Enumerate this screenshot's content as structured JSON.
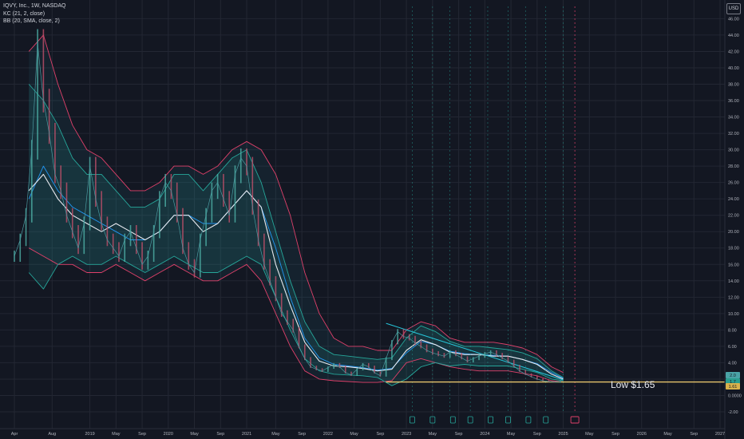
{
  "legend": {
    "line1": "IQVY, Inc., 1W, NASDAQ",
    "line2": "KC (21, 2, close)",
    "line3": "BB (20, SMA, close, 2)"
  },
  "currency": "USD",
  "annotation": {
    "text": "Low $1.65",
    "level": 1.65
  },
  "price_tags": [
    {
      "value": "2.0",
      "price": 2.0,
      "color": "#4aa3a6"
    },
    {
      "value": "1.7",
      "price": 1.7,
      "color": "#2a9d8f"
    },
    {
      "value": "1.61",
      "price": 1.61,
      "color": "#d9b24c"
    }
  ],
  "colors": {
    "background": "#131722",
    "grid": "#232733",
    "price": "#4a9aa0",
    "keltner": "#e0406a",
    "bollinger": "#26a69a",
    "basis": "#e8eaf0",
    "ema": "#2196f3",
    "support": "#e8c66d",
    "trendline": "#26c6da",
    "event_marker": "#26a69a",
    "session_line": "#26a69a",
    "cursor": "#e0406a"
  },
  "chart_data": {
    "type": "line",
    "x_axis": {
      "ticks": [
        "Apr",
        "Aug",
        "2019",
        "May",
        "Sep",
        "2020",
        "May",
        "Sep",
        "2021",
        "May",
        "Sep",
        "2022",
        "May",
        "Sep",
        "2023",
        "May",
        "Sep",
        "2024",
        "May",
        "Sep",
        "2025",
        "May",
        "Sep",
        "2026",
        "May",
        "Sep",
        "2027"
      ],
      "tick_index": [
        0,
        1.3,
        2.6,
        3.5,
        4.4,
        5.3,
        6.2,
        7.1,
        8.0,
        9.0,
        9.9,
        10.8,
        11.7,
        12.6,
        13.5,
        14.4,
        15.3,
        16.2,
        17.1,
        18.0,
        18.9,
        19.8,
        20.7,
        21.6,
        22.5,
        23.4,
        24.3
      ]
    },
    "y_axis": {
      "ylim": [
        -2.0,
        47.5
      ],
      "ticks": [
        "46.00",
        "44.00",
        "42.00",
        "40.00",
        "38.00",
        "36.00",
        "34.00",
        "32.00",
        "30.00",
        "28.00",
        "26.00",
        "24.00",
        "22.00",
        "20.00",
        "18.00",
        "16.00",
        "14.00",
        "12.00",
        "10.00",
        "8.00",
        "6.00",
        "4.00",
        "2.00",
        "0.0000",
        "-2.00"
      ],
      "tick_values": [
        46,
        44,
        42,
        40,
        38,
        36,
        34,
        32,
        30,
        28,
        26,
        24,
        22,
        20,
        18,
        16,
        14,
        12,
        10,
        8,
        6,
        4,
        2,
        0,
        -2
      ]
    },
    "grid": true,
    "series": [
      {
        "key": "close",
        "x": [
          0,
          0.2,
          0.4,
          0.6,
          0.8,
          1.0,
          1.2,
          1.4,
          1.6,
          1.8,
          2.0,
          2.2,
          2.4,
          2.6,
          2.8,
          3.0,
          3.2,
          3.4,
          3.6,
          3.8,
          4.0,
          4.2,
          4.4,
          4.6,
          4.8,
          5.0,
          5.2,
          5.4,
          5.6,
          5.8,
          6.0,
          6.2,
          6.4,
          6.6,
          6.8,
          7.0,
          7.2,
          7.4,
          7.6,
          7.8,
          8.0,
          8.2,
          8.4,
          8.6,
          8.8,
          9.0,
          9.2,
          9.4,
          9.6,
          9.8,
          10.0,
          10.2,
          10.4,
          10.6,
          10.8,
          11.0,
          11.2,
          11.4,
          11.6,
          11.8,
          12.0,
          12.2,
          12.4,
          12.6,
          12.8,
          13.0,
          13.2,
          13.4,
          13.6,
          13.8,
          14.0,
          14.2,
          14.4,
          14.6,
          14.8,
          15.0,
          15.2,
          15.4,
          15.6,
          15.8,
          16.0,
          16.2,
          16.4,
          16.6,
          16.8,
          17.0,
          17.2,
          17.4,
          17.6,
          17.8,
          18.0,
          18.2,
          18.4,
          18.6,
          18.8
        ],
        "values": [
          17,
          19,
          22,
          30,
          43,
          36,
          32,
          27,
          25,
          22,
          20,
          18,
          21,
          28,
          24,
          21,
          19,
          18,
          17,
          19,
          20,
          18,
          16,
          17,
          20,
          24,
          26,
          25,
          22,
          18,
          16,
          15,
          19,
          22,
          25,
          26,
          24,
          22,
          27,
          29,
          28,
          23,
          19,
          16,
          14,
          12,
          10,
          9,
          8,
          6,
          4.5,
          3.5,
          3.2,
          3.0,
          3.4,
          3.8,
          3.5,
          2.8,
          2.5,
          3.2,
          3.8,
          3.5,
          2.8,
          2.4,
          4.5,
          6.5,
          7.8,
          7.2,
          7.0,
          6.4,
          6.0,
          5.5,
          5.2,
          5.0,
          4.8,
          5.3,
          5.0,
          4.6,
          4.2,
          4.5,
          4.8,
          5.1,
          5.3,
          5.0,
          4.6,
          4.2,
          3.6,
          3.0,
          2.6,
          2.3,
          2.0,
          1.8,
          1.7,
          1.65,
          1.7
        ]
      },
      {
        "key": "kc_upper",
        "x": [
          0.5,
          1.0,
          1.5,
          2.0,
          2.5,
          3.0,
          3.5,
          4.0,
          4.5,
          5.0,
          5.5,
          6.0,
          6.5,
          7.0,
          7.5,
          8.0,
          8.5,
          9.0,
          9.5,
          10.0,
          10.5,
          11.0,
          11.5,
          12.0,
          12.5,
          13.0,
          13.5,
          14.0,
          14.5,
          15.0,
          15.5,
          16.0,
          16.5,
          17.0,
          17.5,
          18.0,
          18.5,
          18.9
        ],
        "values": [
          42,
          44,
          38,
          33,
          30,
          29,
          27,
          25,
          25,
          26,
          28,
          28,
          27,
          28,
          30,
          31,
          30,
          27,
          22,
          15,
          10,
          7,
          6,
          6,
          5.5,
          5.5,
          8,
          9,
          8.5,
          7,
          6.5,
          6.5,
          6.5,
          6.2,
          5.8,
          5,
          3.5,
          2.8
        ]
      },
      {
        "key": "kc_lower",
        "x": [
          0.5,
          1.0,
          1.5,
          2.0,
          2.5,
          3.0,
          3.5,
          4.0,
          4.5,
          5.0,
          5.5,
          6.0,
          6.5,
          7.0,
          7.5,
          8.0,
          8.5,
          9.0,
          9.5,
          10.0,
          10.5,
          11.0,
          11.5,
          12.0,
          12.5,
          13.0,
          13.5,
          14.0,
          14.5,
          15.0,
          15.5,
          16.0,
          16.5,
          17.0,
          17.5,
          18.0,
          18.5,
          18.9
        ],
        "values": [
          18,
          17,
          16,
          16,
          15,
          15,
          16,
          15,
          14,
          15,
          16,
          15,
          14,
          14,
          15,
          16,
          14,
          10,
          6,
          3,
          2,
          1.8,
          1.7,
          1.6,
          1.6,
          1.8,
          4,
          4.5,
          4,
          3.5,
          3.2,
          3,
          3,
          3,
          2.7,
          2.4,
          1.8,
          1.65
        ]
      },
      {
        "key": "bb_upper",
        "x": [
          0.5,
          1.0,
          1.5,
          2.0,
          2.5,
          3.0,
          3.5,
          4.0,
          4.5,
          5.0,
          5.5,
          6.0,
          6.5,
          7.0,
          7.5,
          8.0,
          8.5,
          9.0,
          9.5,
          10.0,
          10.5,
          11.0,
          11.5,
          12.0,
          12.5,
          13.0,
          13.5,
          14.0,
          14.5,
          15.0,
          15.5,
          16.0,
          16.5,
          17.0,
          17.5,
          18.0,
          18.5,
          18.9
        ],
        "values": [
          38,
          36,
          33,
          29,
          27,
          27,
          25,
          23,
          23,
          24,
          27,
          27,
          25,
          27,
          29,
          30,
          26,
          20,
          14,
          9,
          6,
          5,
          4.8,
          4.6,
          4.4,
          4.6,
          7,
          8.5,
          7.8,
          6.6,
          6,
          6,
          5.8,
          5.6,
          5.2,
          4.5,
          3,
          2.2
        ]
      },
      {
        "key": "bb_lower",
        "x": [
          0.5,
          1.0,
          1.5,
          2.0,
          2.5,
          3.0,
          3.5,
          4.0,
          4.5,
          5.0,
          5.5,
          6.0,
          6.5,
          7.0,
          7.5,
          8.0,
          8.5,
          9.0,
          9.5,
          10.0,
          10.5,
          11.0,
          11.5,
          12.0,
          12.5,
          13.0,
          13.5,
          14.0,
          14.5,
          15.0,
          15.5,
          16.0,
          16.5,
          17.0,
          17.5,
          18.0,
          18.5,
          18.9
        ],
        "values": [
          15,
          13,
          16,
          17,
          16,
          16,
          17,
          16,
          15,
          16,
          17,
          16,
          15,
          15,
          16,
          17,
          16,
          12,
          8,
          4.5,
          3,
          2.6,
          2.5,
          2.4,
          2.2,
          1.2,
          2,
          3.5,
          4,
          3.6,
          3.8,
          3.6,
          3.6,
          3.6,
          3.2,
          2.8,
          2,
          1.8
        ]
      },
      {
        "key": "basis",
        "x": [
          0.5,
          1.0,
          1.5,
          2.0,
          2.5,
          3.0,
          3.5,
          4.0,
          4.5,
          5.0,
          5.5,
          6.0,
          6.5,
          7.0,
          7.5,
          8.0,
          8.5,
          9.0,
          9.5,
          10.0,
          10.5,
          11.0,
          11.5,
          12.0,
          12.5,
          13.0,
          13.5,
          14.0,
          14.5,
          15.0,
          15.5,
          16.0,
          16.5,
          17.0,
          17.5,
          18.0,
          18.5,
          18.9
        ],
        "values": [
          25,
          27,
          24,
          22,
          21,
          20,
          21,
          20,
          19,
          20,
          22,
          22,
          20,
          21,
          23,
          25,
          23,
          16,
          11,
          6.5,
          4.2,
          3.6,
          3.5,
          3.3,
          3.0,
          3.2,
          5.5,
          6.8,
          6.2,
          5.3,
          5,
          5,
          4.8,
          4.8,
          4.4,
          3.8,
          2.6,
          2.0
        ]
      },
      {
        "key": "ema",
        "x": [
          0.5,
          1.0,
          1.5,
          2.0,
          2.5,
          3.0,
          3.5,
          4.0,
          4.5,
          5.0,
          5.5,
          6.0,
          6.5,
          7.0,
          7.5,
          8.0,
          8.5,
          9.0,
          9.5,
          10.0,
          10.5,
          11.0,
          11.5,
          12.0,
          12.5,
          13.0,
          13.5,
          14.0,
          14.5,
          15.0,
          15.5,
          16.0,
          16.5,
          17.0,
          17.5,
          18.0,
          18.5,
          18.9
        ],
        "values": [
          24,
          28,
          25,
          23,
          22,
          21,
          20,
          19,
          19,
          20,
          22,
          22,
          21,
          21,
          23,
          25,
          23,
          18,
          12,
          7,
          4.6,
          3.8,
          3.6,
          3.4,
          3.1,
          3.3,
          5.2,
          6.6,
          6.2,
          5.4,
          5.1,
          5,
          4.9,
          4.8,
          4.4,
          3.9,
          2.8,
          2.1
        ]
      }
    ],
    "support_line": {
      "y": 1.65,
      "x_start": 12.8,
      "x_end": 24.3
    },
    "trendline": {
      "x": [
        12.8,
        18.9
      ],
      "y": [
        8.8,
        1.9
      ]
    },
    "vertical_markers_x": [
      13.7,
      14.4,
      15.0,
      15.7,
      16.3,
      17.0,
      17.6,
      18.3,
      18.9
    ],
    "event_markers_x": [
      13.7,
      14.4,
      15.1,
      15.7,
      16.4,
      17.0,
      17.7,
      18.3
    ],
    "cursor_x": 19.3
  }
}
